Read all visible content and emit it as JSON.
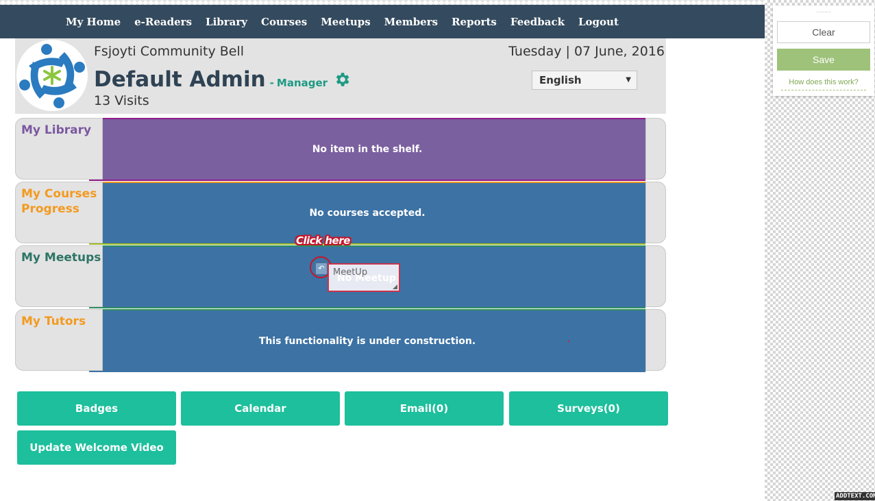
{
  "nav": {
    "items": [
      "My Home",
      "e-Readers",
      "Library",
      "Courses",
      "Meetups",
      "Members",
      "Reports",
      "Feedback",
      "Logout"
    ]
  },
  "header": {
    "community": "Fsjoyti Community Bell",
    "date": "Tuesday | 07 June, 2016",
    "admin_name": "Default Admin",
    "role_separator": "-",
    "role": "Manager",
    "visits": "13 Visits",
    "language": "English"
  },
  "sections": {
    "library": {
      "label": "My Library",
      "label_color": "#7b58a0",
      "message": "No item in the shelf.",
      "bg": "#7b60a0"
    },
    "courses": {
      "label": "My Courses Progress",
      "label_color": "#f39a1f",
      "message": "No courses accepted.",
      "bg": "#3c72a4"
    },
    "meetups": {
      "label": "My Meetups",
      "label_color": "#2e7566",
      "message": "No Meetup",
      "bg": "#3c72a4"
    },
    "tutors": {
      "label": "My Tutors",
      "label_color": "#f39a1f",
      "message": "This functionality is under construction.",
      "bg": "#3c72a4"
    }
  },
  "annotation": {
    "callout": "Click here",
    "popup_text": "MeetUp"
  },
  "buttons": {
    "badges": "Badges",
    "calendar": "Calendar",
    "email": "Email(0)",
    "surveys": "Surveys(0)",
    "welcome_video": "Update Welcome Video"
  },
  "widget": {
    "grip": "………",
    "clear": "Clear",
    "save": "Save",
    "help": "How does this work?",
    "watermark": "ADDTEXT.COM"
  },
  "colors": {
    "nav_bg": "#344a5e",
    "accent_teal": "#1dbf9c",
    "manager_green": "#1c9a83"
  }
}
